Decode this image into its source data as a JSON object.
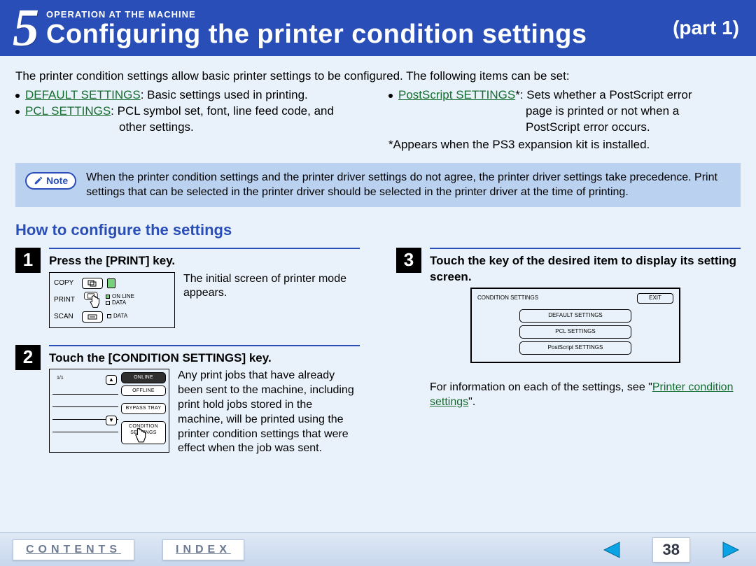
{
  "header": {
    "chapter_num": "5",
    "section_label": "OPERATION AT THE MACHINE",
    "title": "Configuring the printer condition settings",
    "part": "(part 1)"
  },
  "intro": {
    "lead": "The printer condition settings allow basic printer settings to be configured. The following items can be set:",
    "left": {
      "item1_link": "DEFAULT SETTINGS",
      "item1_rest": ": Basic settings used in printing.",
      "item2_link": "PCL SETTINGS",
      "item2_rest": ": PCL symbol set, font, line feed code, and",
      "item2_hang": "other settings."
    },
    "right": {
      "item1_link": "PostScript SETTINGS",
      "item1_star": "*",
      "item1_rest": ": Sets whether a PostScript error",
      "item1_hang1": "page is printed or not when a",
      "item1_hang2": "PostScript error occurs.",
      "psnote": "*Appears when the PS3 expansion kit is installed."
    }
  },
  "note": {
    "label": "Note",
    "text": "When the printer condition settings and the printer driver settings do not agree, the printer driver settings take precedence. Print settings that can be selected in the printer driver should be selected in the printer driver at the time of printing."
  },
  "howto_heading": "How to configure the settings",
  "steps": {
    "s1": {
      "num": "1",
      "title": "Press the [PRINT] key.",
      "text": "The initial screen of printer mode appears.",
      "panel": {
        "copy": "COPY",
        "print": "PRINT",
        "scan": "SCAN",
        "online": "ON LINE",
        "data1": "DATA",
        "data2": "DATA"
      }
    },
    "s2": {
      "num": "2",
      "title": "Touch the [CONDITION SETTINGS] key.",
      "text": "Any print jobs that have already been sent to the machine, including print hold jobs stored in the machine, will be printed using the printer condition settings that were effect when the job was sent.",
      "panel": {
        "page": "1/1",
        "online": "ONLINE",
        "offline": "OFFLINE",
        "bypass": "BYPASS TRAY",
        "cond1": "CONDITION",
        "cond2": "SETTINGS"
      }
    },
    "s3": {
      "num": "3",
      "title": "Touch the key of the desired item to display its setting screen.",
      "panel": {
        "header": "CONDITION SETTINGS",
        "exit": "EXIT",
        "b1": "DEFAULT SETTINGS",
        "b2": "PCL SETTINGS",
        "b3": "PostScript SETTINGS"
      },
      "after_pre": "For information on each of the settings, see \"",
      "after_link": "Printer condition settings",
      "after_post": "\"."
    }
  },
  "footer": {
    "contents": "CONTENTS",
    "index": "INDEX",
    "page": "38"
  }
}
